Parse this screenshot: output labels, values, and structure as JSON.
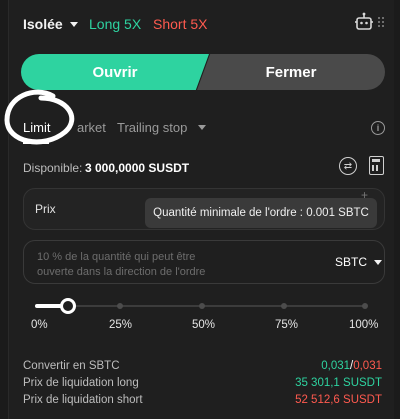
{
  "header": {
    "margin_mode": "Isolée",
    "long_leverage": "Long 5X",
    "short_leverage": "Short 5X"
  },
  "actions": {
    "open": "Ouvrir",
    "close": "Fermer"
  },
  "order_tabs": {
    "limit": "Limit",
    "market": "arket",
    "trailing": "Trailing stop"
  },
  "available": {
    "label": "Disponible:",
    "value": "3 000,0000 SUSDT"
  },
  "price": {
    "label": "Prix"
  },
  "tooltip": {
    "text": "Quantité minimale de l'ordre : 0.001 SBTC"
  },
  "quantity": {
    "placeholder_line1": "10 % de la quantité qui peut être",
    "placeholder_line2": "ouverte dans la direction de l'ordre",
    "unit": "SBTC"
  },
  "slider": {
    "value_percent": 10,
    "ticks": [
      "0%",
      "25%",
      "50%",
      "75%",
      "100%"
    ]
  },
  "info": {
    "convert_label": "Convertir en SBTC",
    "convert_long": "0,031",
    "convert_sep": "/",
    "convert_short": "0,031",
    "liq_long_label": "Prix de liquidation long",
    "liq_long_value": "35 301,1 SUSDT",
    "liq_short_label": "Prix de liquidation short",
    "liq_short_value": "52 512,6 SUSDT"
  },
  "colors": {
    "accent_green": "#2ed3a0",
    "accent_red": "#ff5a4f",
    "background": "#1f1f1f"
  }
}
